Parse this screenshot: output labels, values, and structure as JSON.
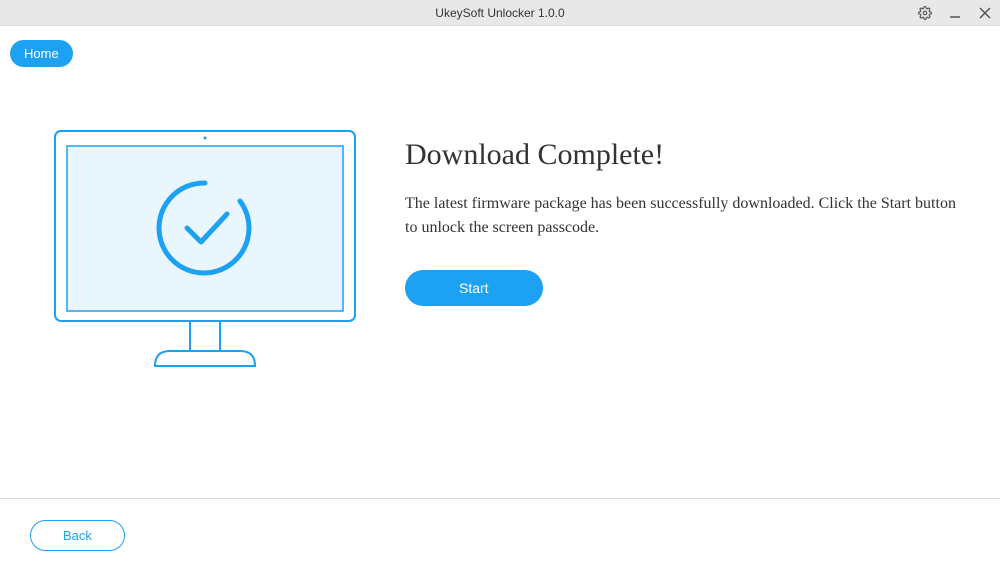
{
  "titlebar": {
    "title": "UkeySoft Unlocker 1.0.0"
  },
  "nav": {
    "home_label": "Home"
  },
  "main": {
    "heading": "Download Complete!",
    "description": "The latest firmware package has been successfully downloaded. Click the Start button to unlock the screen passcode.",
    "start_label": "Start"
  },
  "footer": {
    "back_label": "Back"
  },
  "colors": {
    "accent": "#1da1f2",
    "titlebar_bg": "#e8e8e8"
  }
}
